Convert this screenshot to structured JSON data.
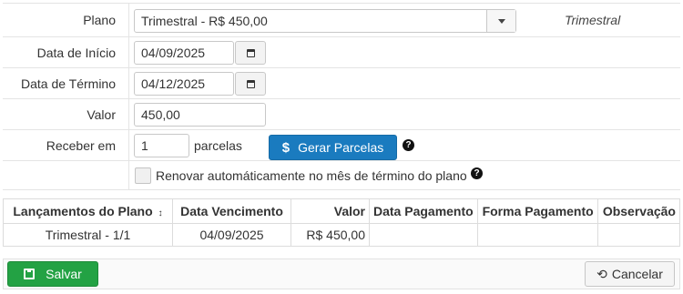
{
  "form": {
    "plano": {
      "label": "Plano",
      "selected": "Trimestral - R$ 450,00",
      "hint": "Trimestral"
    },
    "data_inicio": {
      "label": "Data de Início",
      "value": "04/09/2025"
    },
    "data_termino": {
      "label": "Data de Término",
      "value": "04/12/2025"
    },
    "valor": {
      "label": "Valor",
      "value": "450,00"
    },
    "receber": {
      "label": "Receber em",
      "value": "1",
      "unit": "parcelas",
      "button_label": "Gerar Parcelas",
      "button_icon": "$"
    },
    "renovar": {
      "label": "Renovar automáticamente no mês de término do plano",
      "checked": false
    },
    "help_icon": "?"
  },
  "table": {
    "headers": [
      "Lançamentos do Plano",
      "Data Vencimento",
      "Valor",
      "Data Pagamento",
      "Forma Pagamento",
      "Observação"
    ],
    "sort_icon": "⌃⌄",
    "rows": [
      [
        "Trimestral - 1/1",
        "04/09/2025",
        "R$ 450,00",
        "",
        "",
        ""
      ]
    ]
  },
  "footer": {
    "save_label": "Salvar",
    "cancel_label": "Cancelar"
  },
  "colors": {
    "primary_blue": "#1a7bbf",
    "success_green": "#23a244"
  }
}
